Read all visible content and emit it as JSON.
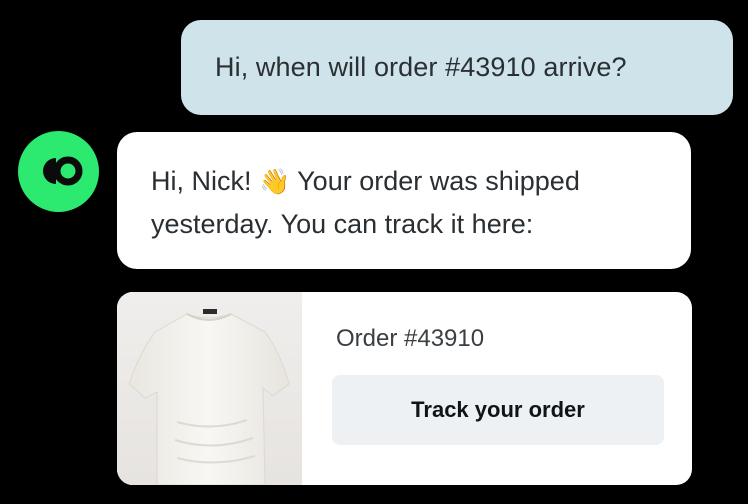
{
  "conversation": {
    "user_message": "Hi, when will order #43910 arrive?",
    "bot_message": {
      "line1_before_emoji": "Hi, Nick! ",
      "emoji": "👋",
      "line1_after_emoji": " Your order was shipped",
      "line2": "yesterday. You can track it here:"
    }
  },
  "order_card": {
    "order_label": "Order #43910",
    "button_label": "Track your order",
    "product_image_icon": "white-dress-photo"
  },
  "avatar": {
    "icon": "brand-logo-icon",
    "color": "#2bea6f"
  },
  "colors": {
    "background": "#000000",
    "user_bubble": "#cfe3ea",
    "bot_bubble": "#ffffff",
    "button_bg": "#edf1f4"
  }
}
